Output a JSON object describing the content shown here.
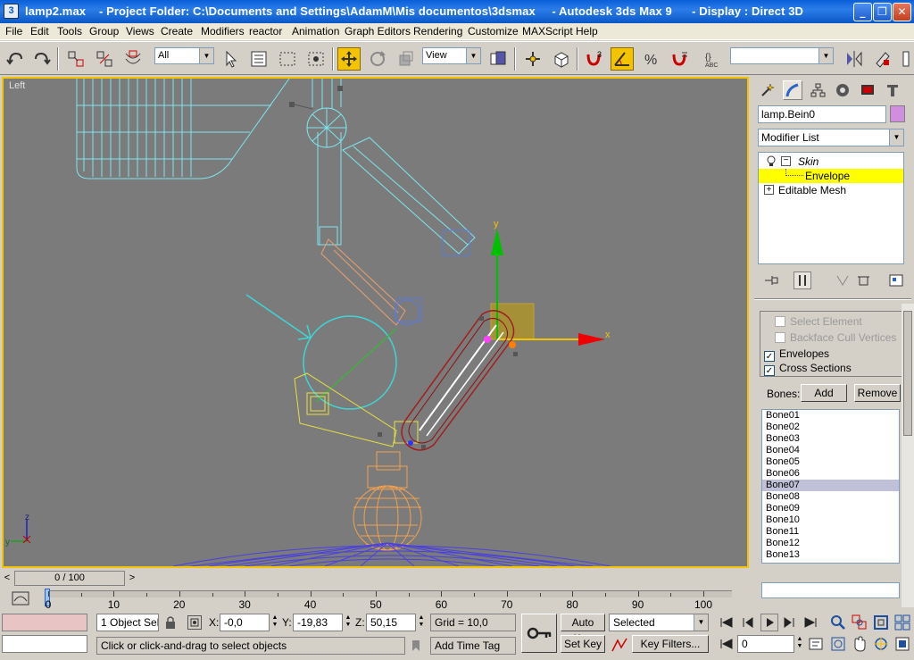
{
  "window": {
    "title": "lamp2.max    - Project Folder: C:\\Documents and Settings\\AdamM\\Mis documentos\\3dsmax     - Autodesk 3ds Max 9      - Display : Direct 3D",
    "minimize": "_",
    "restore": "❐",
    "close": "✕"
  },
  "menu": [
    "File",
    "Edit",
    "Tools",
    "Group",
    "Views",
    "Create",
    "Modifiers",
    "reactor",
    "Animation",
    "Graph Editors",
    "Rendering",
    "Customize",
    "MAXScript",
    "Help"
  ],
  "toolbar": {
    "selection_filter": "All",
    "reference_coord": "View",
    "named_selection": ""
  },
  "viewport": {
    "label": "Left",
    "gizmo_x_label": "x",
    "gizmo_y_label": "y",
    "axis_z_label": "z",
    "axis_y_label": "y"
  },
  "command_panel": {
    "object_name": "lamp.Bein0",
    "object_color": "#d08ee0",
    "modifier_list": "Modifier List",
    "stack": [
      {
        "label": "Skin",
        "type": "modifier"
      },
      {
        "label": "Envelope",
        "type": "sub-object",
        "selected": true
      },
      {
        "label": "Editable Mesh",
        "type": "base"
      }
    ],
    "options": [
      {
        "label": "Select Element",
        "checked": false,
        "enabled": false
      },
      {
        "label": "Backface Cull Vertices",
        "checked": false,
        "enabled": false
      },
      {
        "label": "Envelopes",
        "checked": true,
        "enabled": true
      },
      {
        "label": "Cross Sections",
        "checked": true,
        "enabled": true
      }
    ],
    "bones_label": "Bones:",
    "add_button": "Add",
    "remove_button": "Remove",
    "bones": [
      "Bone01",
      "Bone02",
      "Bone03",
      "Bone04",
      "Bone05",
      "Bone06",
      "Bone07",
      "Bone08",
      "Bone09",
      "Bone10",
      "Bone11",
      "Bone12",
      "Bone13"
    ],
    "selected_bone": "Bone07"
  },
  "timeline": {
    "frame_display": "0 / 100",
    "prev": "<",
    "next": ">",
    "ticks": [
      "0",
      "10",
      "20",
      "30",
      "40",
      "50",
      "60",
      "70",
      "80",
      "90",
      "100"
    ]
  },
  "status": {
    "selection_count": "1 Object Sele",
    "x_label": "X:",
    "x_value": "-0,0",
    "y_label": "Y:",
    "y_value": "-19,83",
    "z_label": "Z:",
    "z_value": "50,15",
    "grid": "Grid = 10,0",
    "prompt": "Click or click-and-drag to select objects",
    "add_time_tag": "Add Time Tag",
    "auto_key": "Auto Key",
    "set_key": "Set Key",
    "key_mode": "Selected",
    "key_filters": "Key Filters...",
    "current_frame": "0"
  }
}
